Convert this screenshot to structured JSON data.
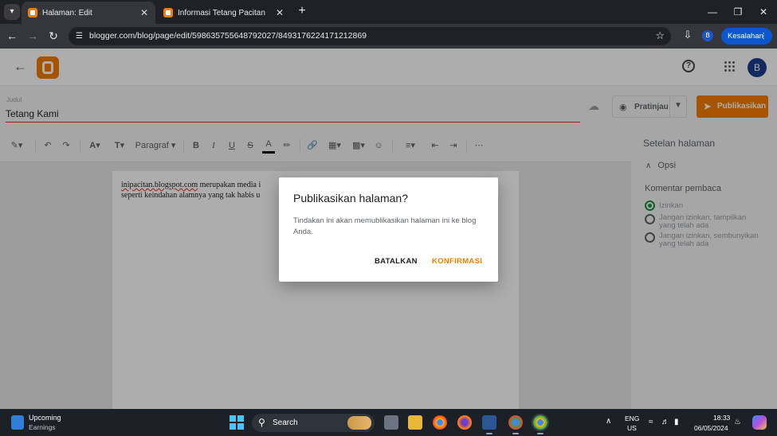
{
  "browser": {
    "tabs": [
      {
        "title": "Halaman: Edit",
        "active": true
      },
      {
        "title": "Informasi Tetang Pacitan",
        "active": false
      }
    ],
    "url": "blogger.com/blog/page/edit/5986357556487920​27/849317622417​1212869",
    "error_chip": "Kesalahan",
    "profile_initial": "B"
  },
  "app": {
    "avatar_initial": "B"
  },
  "editor": {
    "title_label": "Judul",
    "title_value": "Tetang Kami",
    "preview_label": "Pratinjau",
    "publish_label": "Publikasikan",
    "paragraph_label": "Paragraf",
    "body_line1_link": "inipacitan.blogspot.com",
    "body_line1_rest": " merupakan media i",
    "body_line2": "seperti keindahan alamnya yang tak habis u"
  },
  "settings": {
    "title": "Setelan halaman",
    "section": "Opsi",
    "comments_label": "Komentar pembaca",
    "options": [
      {
        "label": "Izinkan",
        "selected": true
      },
      {
        "label": "Jangan izinkan, tampilkan yang telah ada",
        "selected": false
      },
      {
        "label": "Jangan izinkan, sembunyikan yang telah ada",
        "selected": false
      }
    ]
  },
  "dialog": {
    "title": "Publikasikan halaman?",
    "body": "Tindakan ini akan memublikasikan halaman ini ke blog Anda.",
    "cancel": "BATALKAN",
    "confirm": "KONFIRMASI"
  },
  "taskbar": {
    "widget_title": "Upcoming",
    "widget_subtitle": "Earnings",
    "search_label": "Search",
    "lang": "ENG",
    "region": "US",
    "time": "18:33",
    "date": "06/05/2024"
  },
  "colors": {
    "accent": "#f57d00",
    "selected_radio": "#1e8e3e",
    "error_underline": "#d93025"
  }
}
